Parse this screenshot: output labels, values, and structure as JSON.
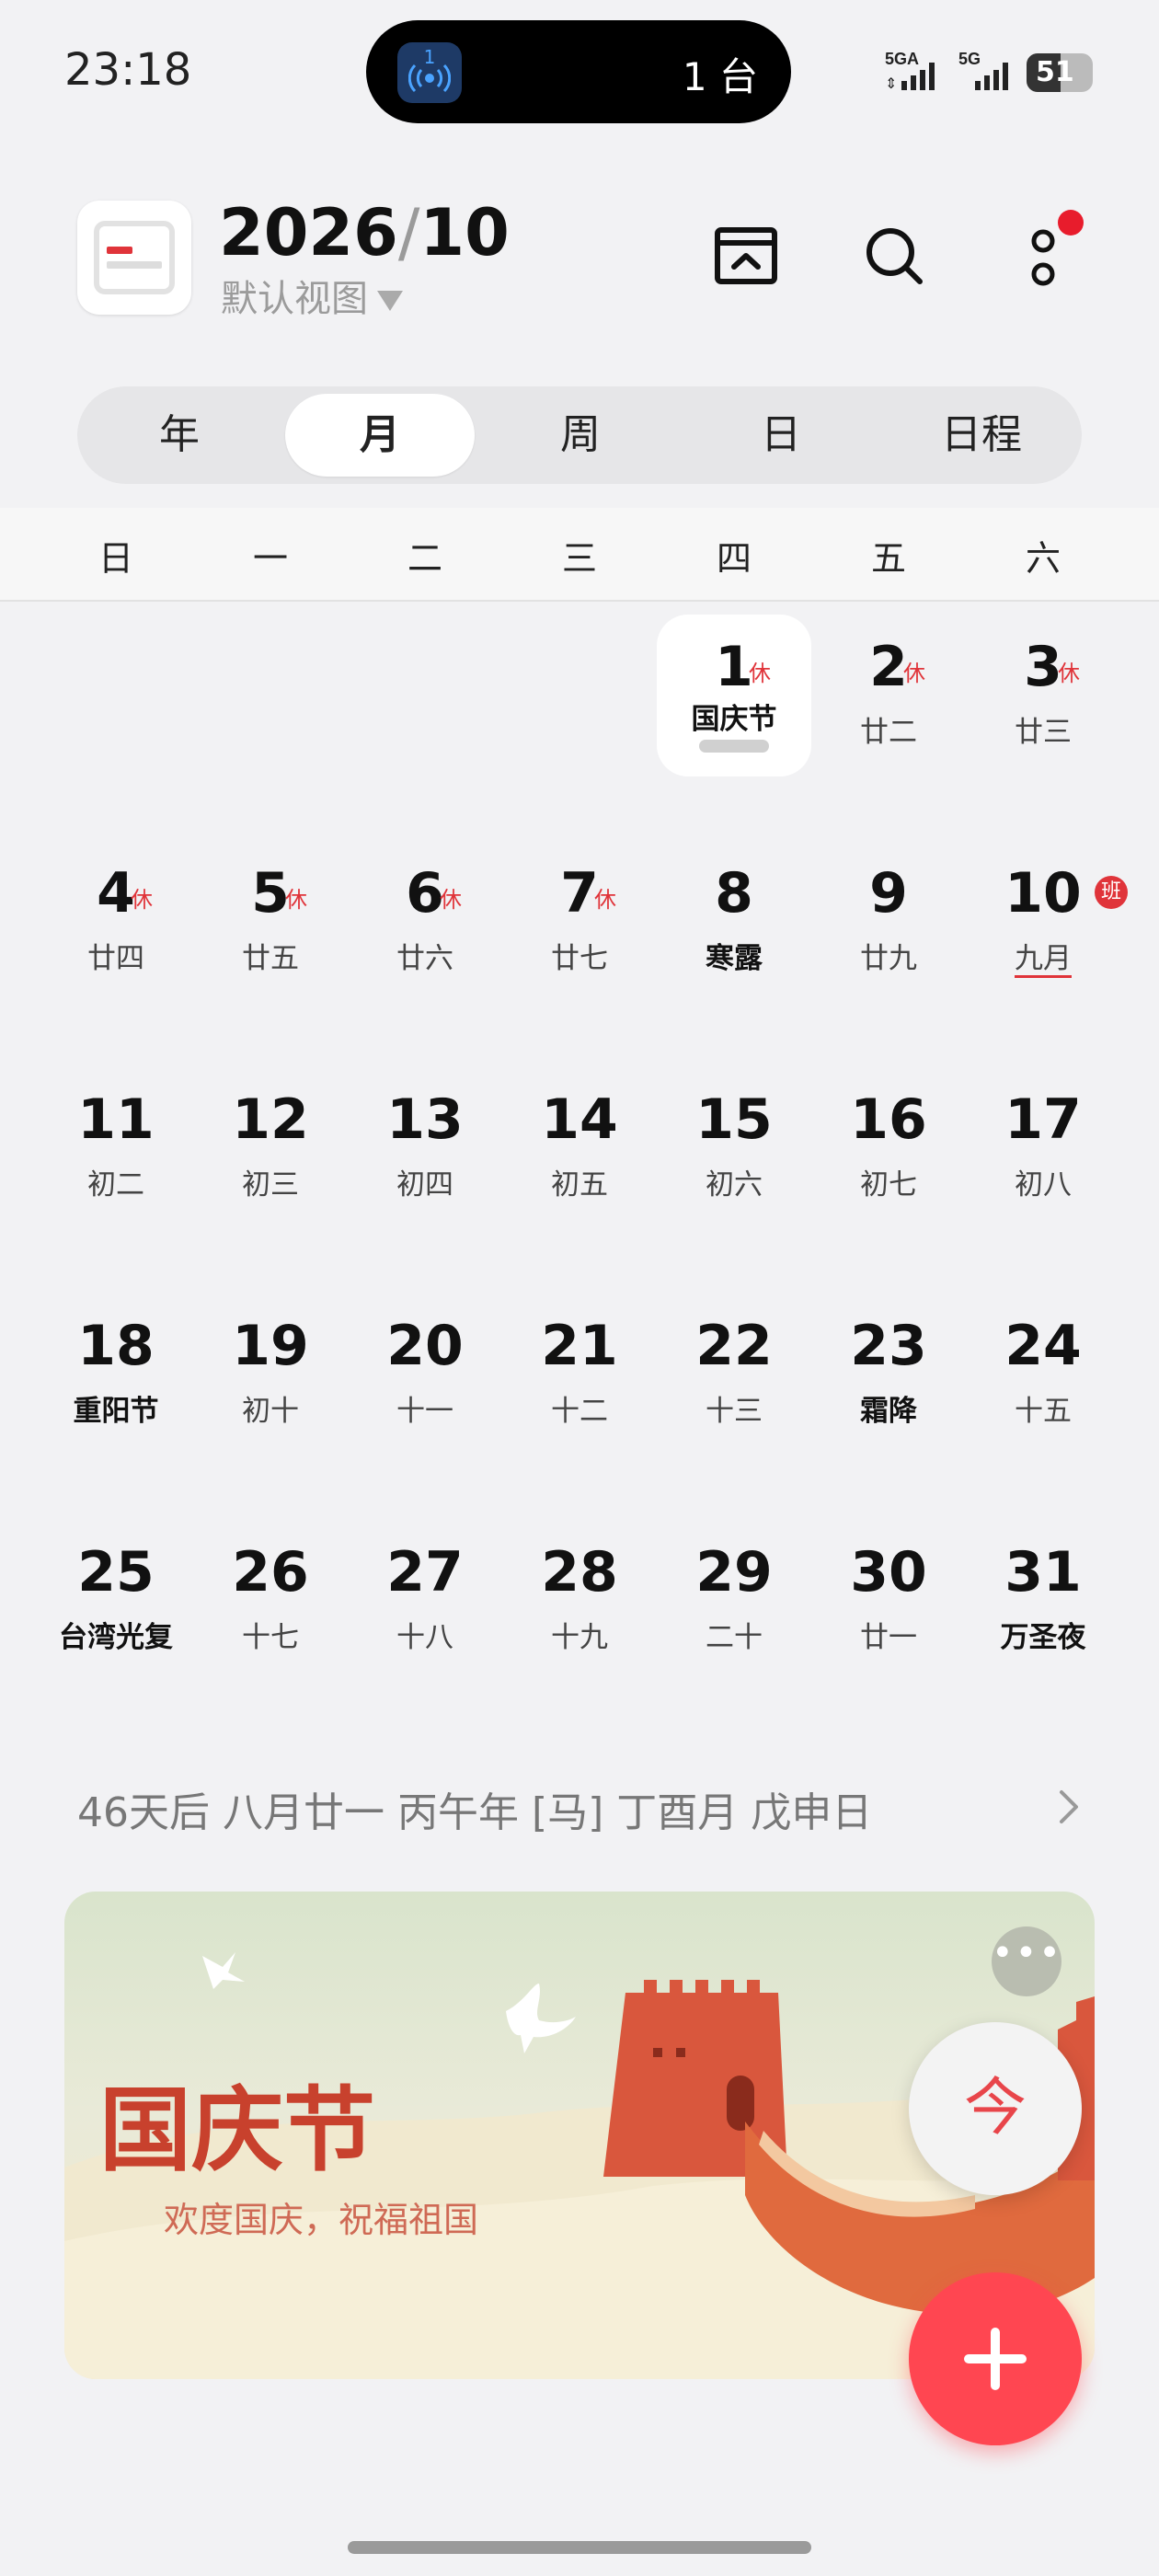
{
  "status_bar": {
    "time": "23:18",
    "island_badge_num": "1",
    "island_text": "1 台",
    "network_1": "5GA",
    "network_2": "5G",
    "battery": "51",
    "battery_level": 0.51
  },
  "header": {
    "year": "2026",
    "slash": "/",
    "month": "10",
    "view_label": "默认视图",
    "icons": [
      "calendar-box-icon",
      "search-icon",
      "more-vertical-icon"
    ]
  },
  "tabs": [
    {
      "label": "年",
      "active": false
    },
    {
      "label": "月",
      "active": true
    },
    {
      "label": "周",
      "active": false
    },
    {
      "label": "日",
      "active": false
    },
    {
      "label": "日程",
      "active": false
    }
  ],
  "weekdays": [
    "日",
    "一",
    "二",
    "三",
    "四",
    "五",
    "六"
  ],
  "calendar": {
    "weeks": [
      [
        null,
        null,
        null,
        null,
        {
          "day": "1",
          "lunar": "国庆节",
          "rest": "休",
          "today": true,
          "bold_lunar": true
        },
        {
          "day": "2",
          "lunar": "廿二",
          "rest": "休"
        },
        {
          "day": "3",
          "lunar": "廿三",
          "rest": "休"
        }
      ],
      [
        {
          "day": "4",
          "lunar": "廿四",
          "rest": "休"
        },
        {
          "day": "5",
          "lunar": "廿五",
          "rest": "休"
        },
        {
          "day": "6",
          "lunar": "廿六",
          "rest": "休"
        },
        {
          "day": "7",
          "lunar": "廿七",
          "rest": "休"
        },
        {
          "day": "8",
          "lunar": "寒露",
          "bold_lunar": true
        },
        {
          "day": "9",
          "lunar": "廿九"
        },
        {
          "day": "10",
          "lunar": "九月",
          "work": "班",
          "underline": true
        }
      ],
      [
        {
          "day": "11",
          "lunar": "初二"
        },
        {
          "day": "12",
          "lunar": "初三"
        },
        {
          "day": "13",
          "lunar": "初四"
        },
        {
          "day": "14",
          "lunar": "初五"
        },
        {
          "day": "15",
          "lunar": "初六"
        },
        {
          "day": "16",
          "lunar": "初七"
        },
        {
          "day": "17",
          "lunar": "初八"
        }
      ],
      [
        {
          "day": "18",
          "lunar": "重阳节",
          "bold_lunar": true
        },
        {
          "day": "19",
          "lunar": "初十"
        },
        {
          "day": "20",
          "lunar": "十一"
        },
        {
          "day": "21",
          "lunar": "十二"
        },
        {
          "day": "22",
          "lunar": "十三"
        },
        {
          "day": "23",
          "lunar": "霜降",
          "bold_lunar": true
        },
        {
          "day": "24",
          "lunar": "十五"
        }
      ],
      [
        {
          "day": "25",
          "lunar": "台湾光复",
          "bold_lunar": true
        },
        {
          "day": "26",
          "lunar": "十七"
        },
        {
          "day": "27",
          "lunar": "十八"
        },
        {
          "day": "28",
          "lunar": "十九"
        },
        {
          "day": "29",
          "lunar": "二十"
        },
        {
          "day": "30",
          "lunar": "廿一"
        },
        {
          "day": "31",
          "lunar": "万圣夜",
          "bold_lunar": true
        }
      ]
    ]
  },
  "info_line": "46天后 八月廿一 丙午年 [马] 丁酉月 戊申日",
  "banner": {
    "title": "国庆节",
    "subtitle": "欢度国庆，祝福祖国",
    "more": "•••"
  },
  "fab": {
    "today_label": "今",
    "add": "plus-icon"
  },
  "colors": {
    "accent": "#e0343a",
    "fab": "#ff4651",
    "background": "#f2f2f4"
  }
}
